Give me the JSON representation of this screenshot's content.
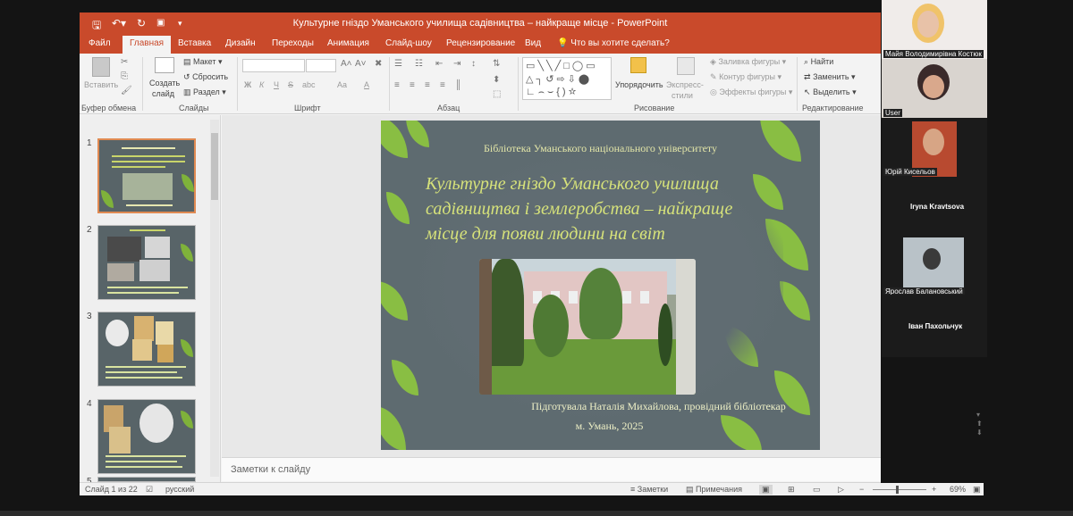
{
  "window": {
    "title": "Культурне гніздо Уманського училища садівництва – найкраще місце - PowerPoint",
    "qat": {
      "save_icon": "save-icon",
      "undo_icon": "undo-icon",
      "redo_icon": "redo-icon",
      "start_icon": "start-slideshow-icon",
      "customize_icon": "customize-icon"
    }
  },
  "tabs": [
    {
      "label": "Файл"
    },
    {
      "label": "Главная"
    },
    {
      "label": "Вставка"
    },
    {
      "label": "Дизайн"
    },
    {
      "label": "Переходы"
    },
    {
      "label": "Анимация"
    },
    {
      "label": "Слайд-шоу"
    },
    {
      "label": "Рецензирование"
    },
    {
      "label": "Вид"
    }
  ],
  "tell_me": "Что вы хотите сделать?",
  "ribbon": {
    "clipboard": {
      "paste": "Вставить",
      "label": "Буфер обмена"
    },
    "slides": {
      "new_slide_1": "Создать",
      "new_slide_2": "слайд",
      "layout": "Макет",
      "reset": "Сбросить",
      "section": "Раздел",
      "label": "Слайды"
    },
    "font": {
      "bold": "Ж",
      "italic": "К",
      "underline": "Ч",
      "strike": "S",
      "spacing": "abc",
      "case": "Aa",
      "color": "A",
      "label": "Шрифт"
    },
    "paragraph": {
      "label": "Абзац"
    },
    "drawing": {
      "arrange": "Упорядочить",
      "quick_styles_1": "Экспресс-",
      "quick_styles_2": "стили",
      "fill": "Заливка фигуры",
      "outline": "Контур фигуры",
      "effects": "Эффекты фигуры",
      "label": "Рисование"
    },
    "editing": {
      "find": "Найти",
      "replace": "Заменить",
      "select": "Выделить",
      "label": "Редактирование"
    }
  },
  "thumbnails": [
    {
      "num": "1"
    },
    {
      "num": "2"
    },
    {
      "num": "3"
    },
    {
      "num": "4"
    },
    {
      "num": "5"
    }
  ],
  "slide": {
    "library": "Бібліотека Уманського національного університету",
    "title_line1": "Культурне гніздо Уманського училища",
    "title_line2": "садівництва  і  землеробства – найкраще",
    "title_line3": "місце для появи людини на світ",
    "prepared_by": "Підготувала  Наталія Михайлова, провідний бібліотекар",
    "city_year": "м. Умань, 2025"
  },
  "notes_placeholder": "Заметки к слайду",
  "status": {
    "slide_counter": "Слайд 1 из 22",
    "language": "русский",
    "notes_btn": "Заметки",
    "comments_btn": "Примечания",
    "zoom": "69%"
  },
  "participants": [
    {
      "name": "Майя Володимирівна Костюк"
    },
    {
      "name": "User"
    },
    {
      "name": "Юрій Кисельов"
    },
    {
      "name": "Iryna Kravtsova"
    },
    {
      "name": "Ярослав Балановський"
    },
    {
      "name": "Іван Пахольчук"
    }
  ],
  "colors": {
    "accent": "#c94a2b",
    "slide_title": "#d6e27a",
    "leaf": "#8dc63f"
  }
}
